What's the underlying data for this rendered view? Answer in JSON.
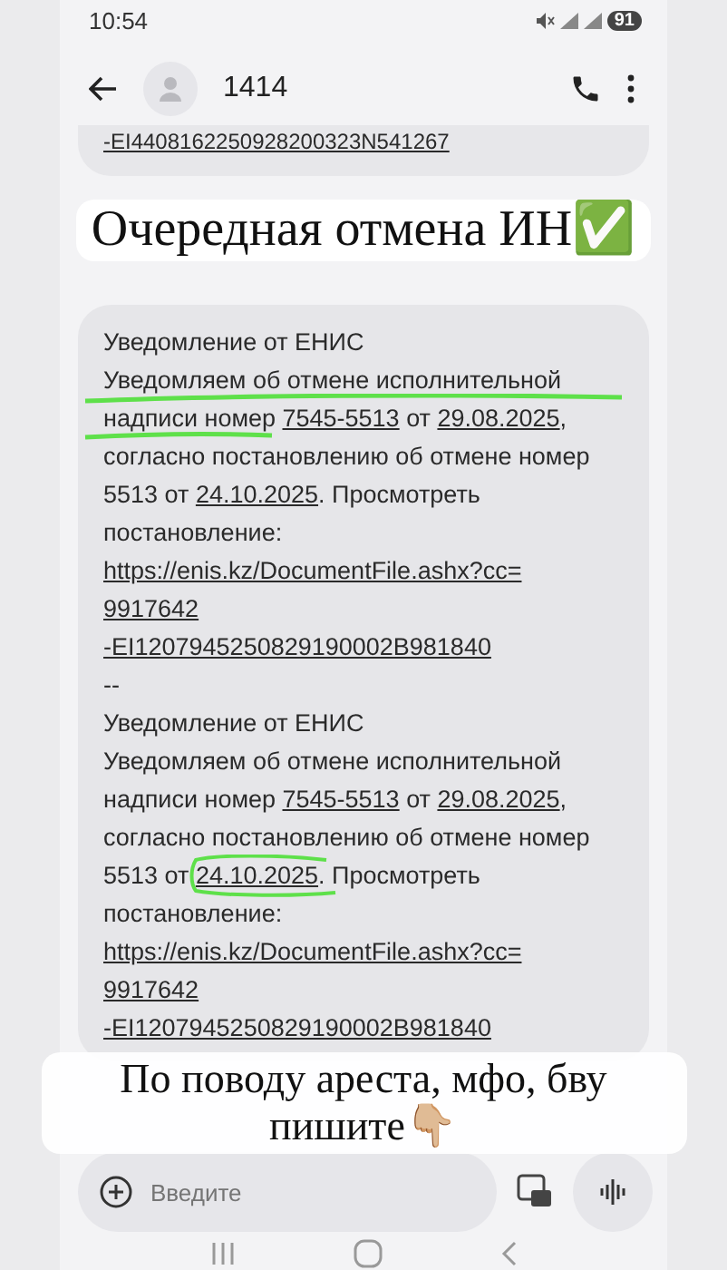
{
  "status_bar": {
    "time": "10:54",
    "battery": "91"
  },
  "header": {
    "title": "1414"
  },
  "cut_text": "-EI4408162250928200323N541267",
  "top_caption": "Очередная отмена ИН✅",
  "bottom_caption": "По поводу ареста, мфо, бву пишите👇🏼",
  "messages": [
    {
      "sender": "Уведомление от ЕНИС",
      "kind": "underlined",
      "segments": [
        {
          "text": "Уведомляем об отмене исполнительной надписи номер ",
          "link": false
        },
        {
          "text": "7545-5513",
          "link": true
        },
        {
          "text": " от ",
          "link": false
        },
        {
          "text": "29.08.2025",
          "link": true
        },
        {
          "text": ", согласно постановлению об отмене номер 5513 от ",
          "link": false
        },
        {
          "text": "24.10.2025",
          "link": true
        },
        {
          "text": ". Просмотреть постановление:",
          "link": false
        }
      ],
      "url_lines": [
        "https://enis.kz/DocumentFile.ashx?cc=",
        "9917642",
        "-EI1207945250829190002B981840"
      ]
    },
    {
      "sender": "Уведомление от ЕНИС",
      "kind": "circled",
      "segments": [
        {
          "text": "Уведомляем об отмене исполнительной надписи номер ",
          "link": false
        },
        {
          "text": "7545-5513",
          "link": true
        },
        {
          "text": " от ",
          "link": false
        },
        {
          "text": "29.08.2025",
          "link": true
        },
        {
          "text": ", согласно постановлению об отмене номер 5513 от ",
          "link": false
        },
        {
          "text": "24.10.2025",
          "link": true
        },
        {
          "text": ". Просмотреть постановление:",
          "link": false
        }
      ],
      "url_lines": [
        "https://enis.kz/DocumentFile.ashx?cc=",
        "9917642",
        "-EI1207945250829190002B981840"
      ]
    }
  ],
  "separator": "--",
  "compose": {
    "placeholder": "Введите"
  }
}
